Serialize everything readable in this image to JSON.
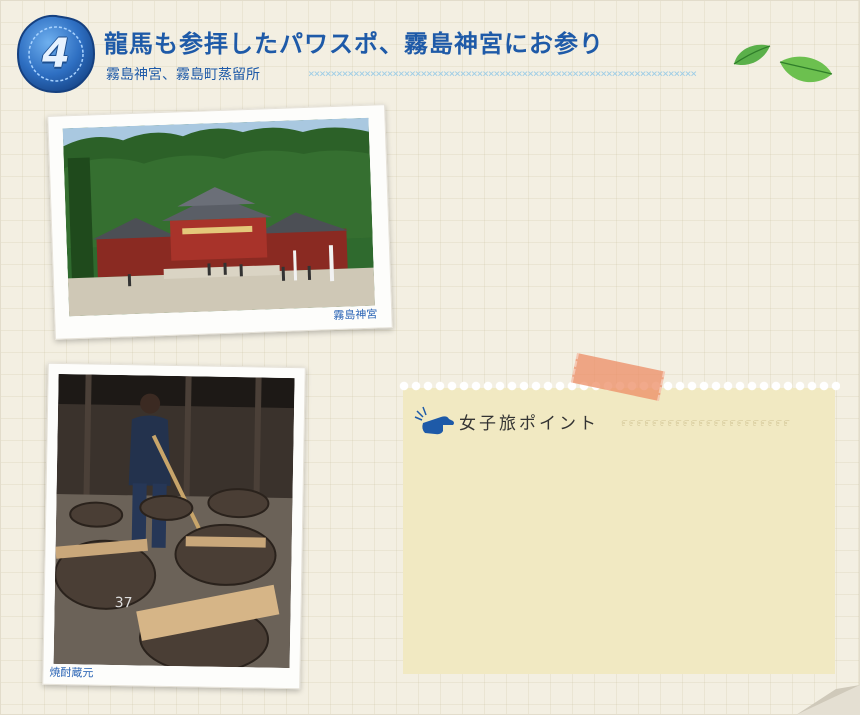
{
  "badge": {
    "number": "4"
  },
  "header": {
    "title": "龍馬も参拝したパワスポ、霧島神宮にお参り",
    "subtitle": "霧島神宮、霧島町蒸留所"
  },
  "photos": [
    {
      "caption": "霧島神宮"
    },
    {
      "caption": "焼酎蔵元"
    }
  ],
  "note": {
    "label": "女子旅ポイント",
    "icon": "pointing-hand-icon"
  },
  "colors": {
    "accent": "#1e5aa8",
    "background": "#f3efe2",
    "note_bg": "#f1e9c2",
    "tape": "#ec8c64"
  }
}
